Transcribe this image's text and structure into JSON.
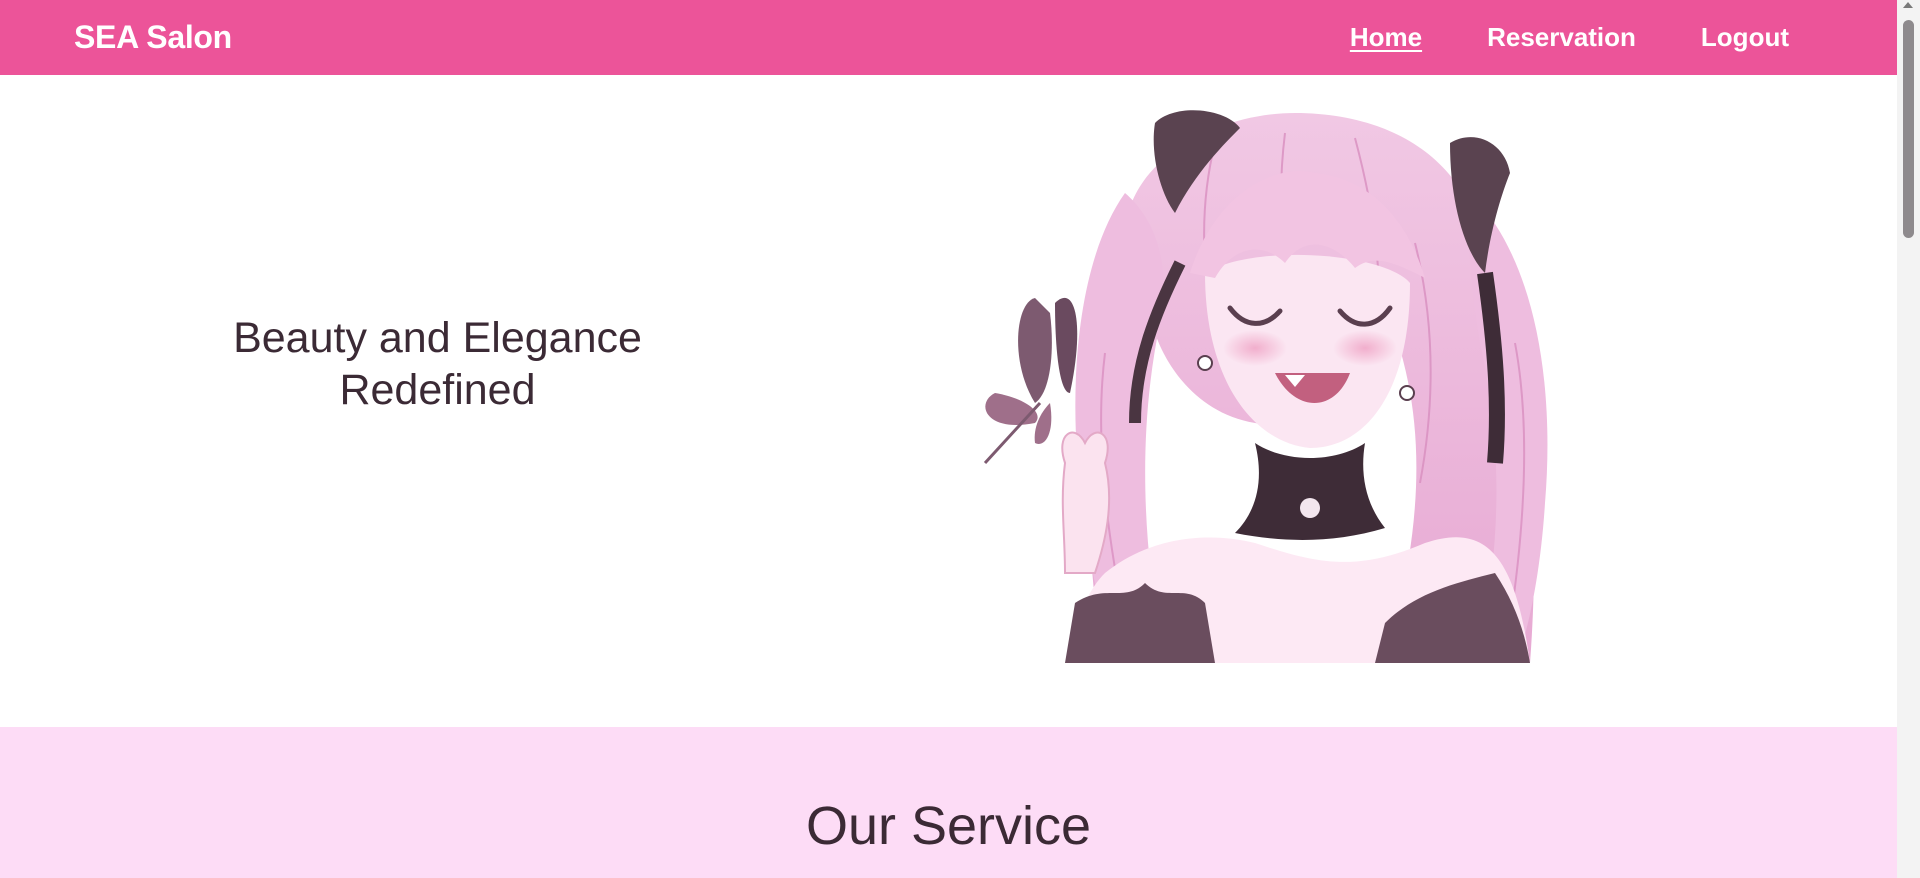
{
  "navbar": {
    "brand": "SEA Salon",
    "links": [
      {
        "label": "Home",
        "active": true
      },
      {
        "label": "Reservation",
        "active": false
      },
      {
        "label": "Logout",
        "active": false
      }
    ]
  },
  "hero": {
    "tagline_line1": "Beauty and Elegance",
    "tagline_line2": "Redefined",
    "image_icon": "anime-girl-illustration"
  },
  "service": {
    "title": "Our Service"
  },
  "colors": {
    "navbar_bg": "#ec5499",
    "service_bg": "#fddcf6",
    "text_dark": "#3b2a35"
  }
}
